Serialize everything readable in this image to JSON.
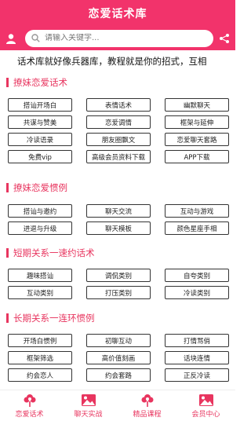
{
  "header": {
    "title": "恋爱话术库"
  },
  "search": {
    "placeholder": "请输入关键字..."
  },
  "marquee": {
    "text": "话术库就好像兵器库，教程就是你的招式，互相"
  },
  "sections": [
    {
      "title": "撩妹恋爱话术",
      "items": [
        "搭讪开场白",
        "表情话术",
        "幽默聊天",
        "共谋与赞美",
        "恋爱调情",
        "框架与延伸",
        "冷读语录",
        "朋友圈飘文",
        "恋爱聊天套路",
        "免费vip",
        "高级会员资料下载",
        "APP下载"
      ]
    },
    {
      "title": "撩妹恋爱惯例",
      "items": [
        "搭讪与邀约",
        "聊天交流",
        "互动与游戏",
        "进退与升级",
        "聊天模板",
        "颜色星座手相"
      ]
    },
    {
      "title": "短期关系一速约话术",
      "items": [
        "趣味搭讪",
        "调侃类别",
        "自夸类别",
        "互动类别",
        "打压类别",
        "冷读类别"
      ]
    },
    {
      "title": "长期关系一连环惯例",
      "items": [
        "开场白惯例",
        "初聊互动",
        "打情骂俏",
        "框架筛选",
        "高价值刻画",
        "话块连情",
        "约会恋人",
        "约会套路",
        "正反冷读"
      ]
    }
  ],
  "tabbar": [
    {
      "label": "恋爱话术",
      "icon": "flower-icon"
    },
    {
      "label": "聊天实战",
      "icon": "image-icon"
    },
    {
      "label": "精品课程",
      "icon": "flower-icon"
    },
    {
      "label": "会员中心",
      "icon": "image-icon"
    }
  ],
  "colors": {
    "primary": "#f2336b",
    "accent": "#e8355f"
  }
}
